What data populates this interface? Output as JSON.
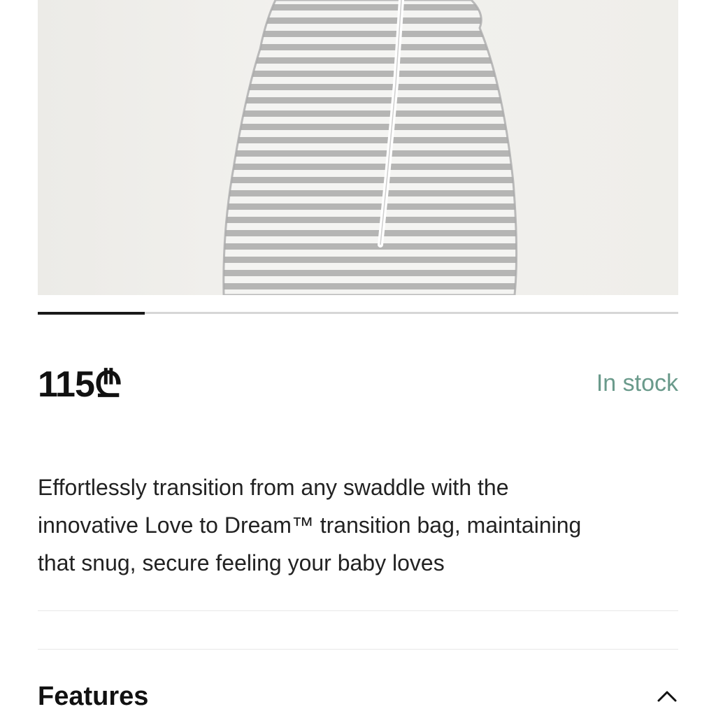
{
  "product": {
    "image_icon": "striped-sleep-bag-photo",
    "carousel_progress": 0.167
  },
  "price": {
    "amount": "115",
    "currency_symbol": "₾"
  },
  "stock": {
    "label": "In stock",
    "color": "#6a9a8b"
  },
  "description": {
    "line1": "Effortlessly transition from any swaddle with the",
    "line2": "innovative Love to Dream™ transition bag, maintaining",
    "line3": "that snug, secure feeling your baby loves"
  },
  "features": {
    "title": "Features",
    "toggle_icon": "chevron-up-icon"
  }
}
